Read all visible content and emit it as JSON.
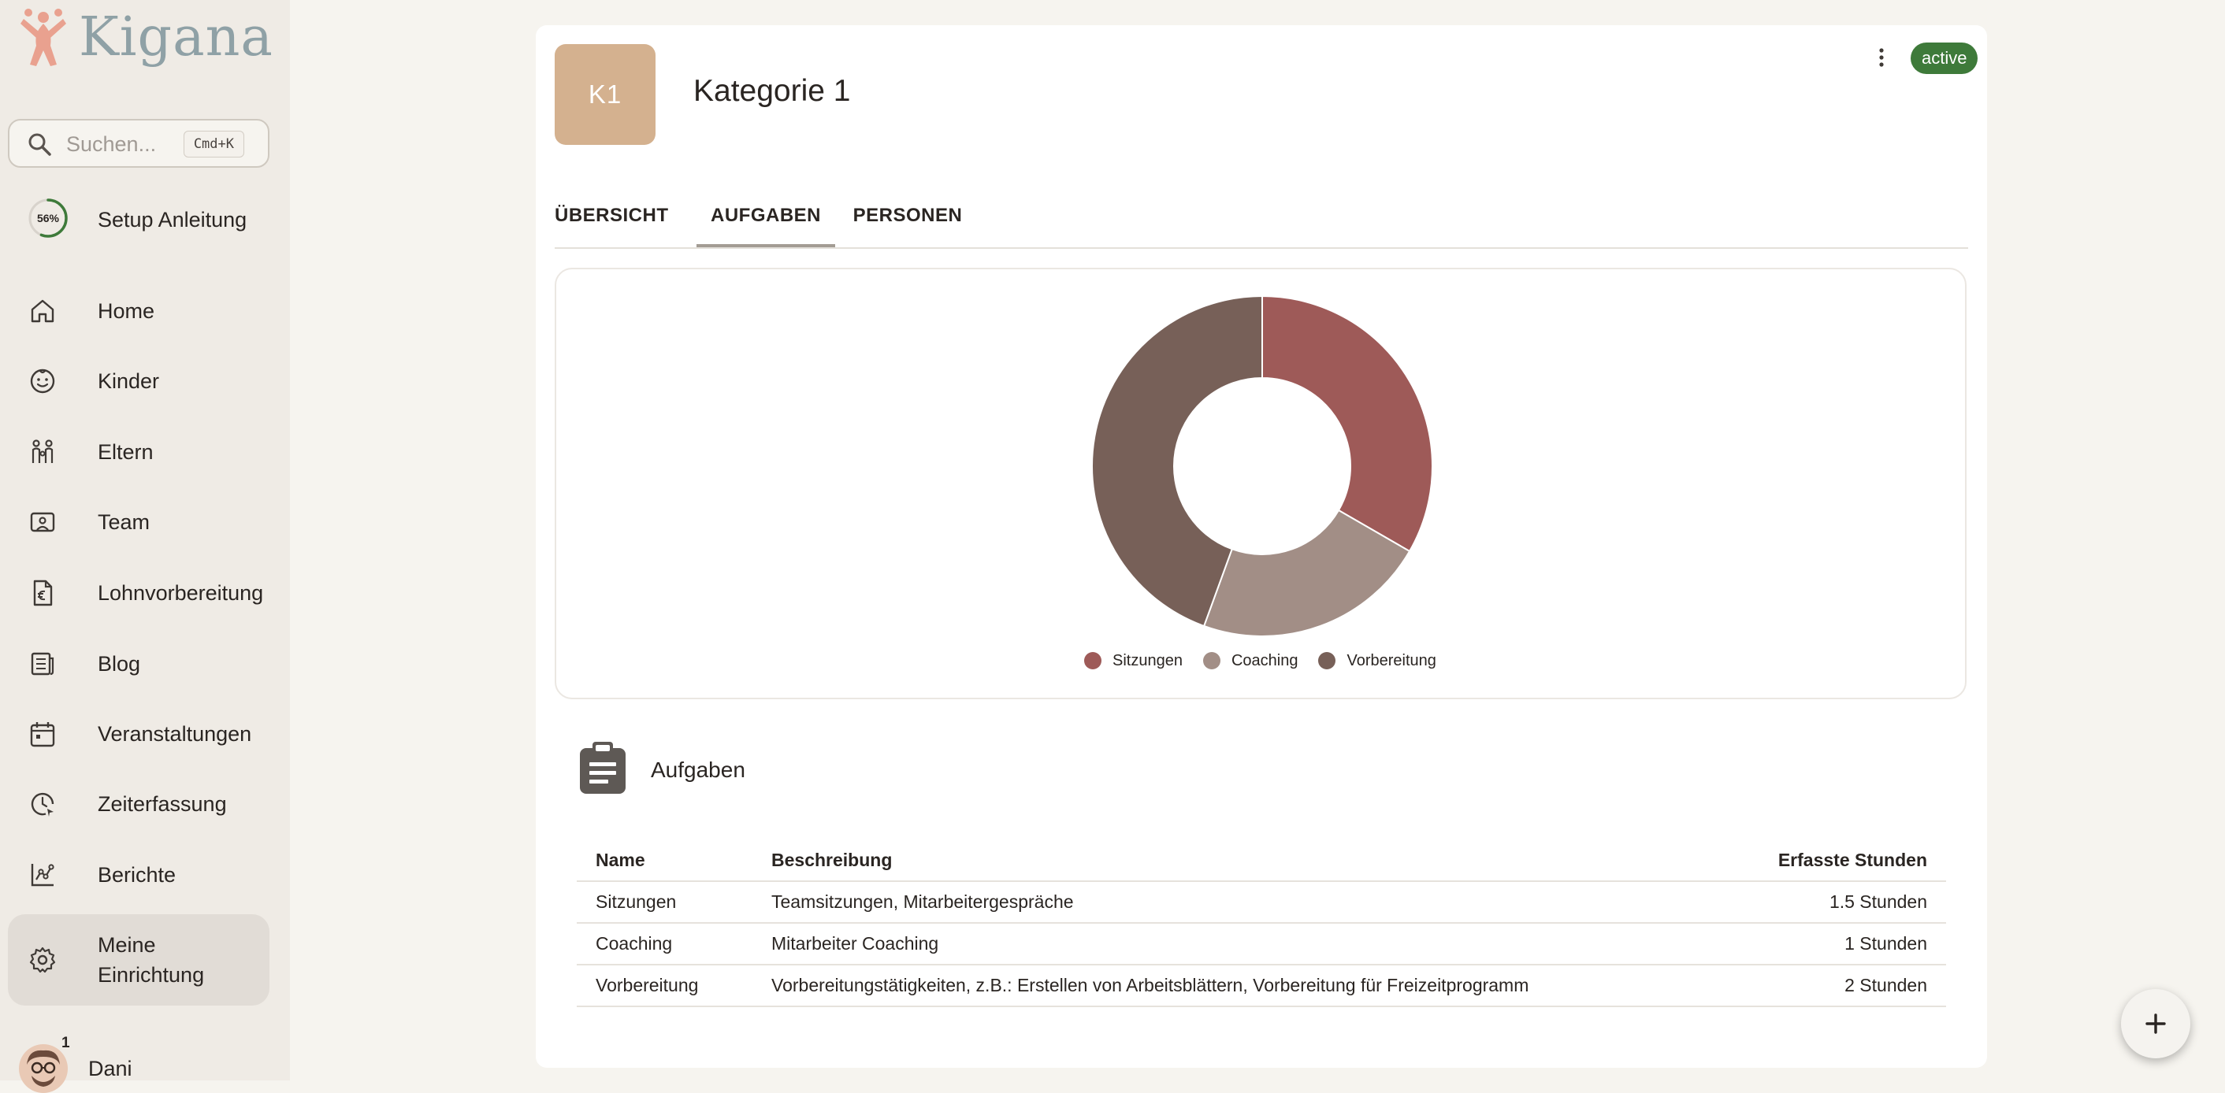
{
  "app": {
    "logo_text": "Kigana"
  },
  "search": {
    "placeholder": "Suchen...",
    "shortcut": "Cmd+K"
  },
  "setup": {
    "label": "Setup Anleitung",
    "progress_text": "56%",
    "progress": 0.56
  },
  "sidebar": {
    "items": [
      {
        "label": "Home",
        "icon": "home-icon"
      },
      {
        "label": "Kinder",
        "icon": "child-face-icon"
      },
      {
        "label": "Eltern",
        "icon": "parents-icon"
      },
      {
        "label": "Team",
        "icon": "team-badge-icon"
      },
      {
        "label": "Lohnvorbereitung",
        "icon": "payroll-document-icon"
      },
      {
        "label": "Blog",
        "icon": "blog-icon"
      },
      {
        "label": "Veranstaltungen",
        "icon": "calendar-icon"
      },
      {
        "label": "Zeiterfassung",
        "icon": "time-tracking-icon"
      },
      {
        "label": "Berichte",
        "icon": "reports-icon"
      },
      {
        "label": "Meine Einrichtung",
        "icon": "gear-icon",
        "active": true
      }
    ]
  },
  "user": {
    "name": "Dani",
    "badge": "1"
  },
  "category": {
    "initials": "K1",
    "title": "Kategorie 1",
    "status": "active"
  },
  "tabs": [
    {
      "label": "ÜBERSICHT"
    },
    {
      "label": "AUFGABEN",
      "active": true
    },
    {
      "label": "PERSONEN"
    }
  ],
  "chart_data": {
    "type": "pie",
    "donut": true,
    "categories": [
      "Sitzungen",
      "Coaching",
      "Vorbereitung"
    ],
    "values": [
      1.5,
      1,
      2
    ],
    "colors": [
      "#9e5a58",
      "#a28e86",
      "#776058"
    ],
    "legend_position": "bottom"
  },
  "tasks": {
    "title": "Aufgaben",
    "columns": [
      "Name",
      "Beschreibung",
      "Erfasste Stunden"
    ],
    "rows": [
      {
        "name": "Sitzungen",
        "description": "Teamsitzungen, Mitarbeitergespräche",
        "hours": "1.5 Stunden"
      },
      {
        "name": "Coaching",
        "description": "Mitarbeiter Coaching",
        "hours": "1 Stunden"
      },
      {
        "name": "Vorbereitung",
        "description": "Vorbereitungstätigkeiten, z.B.: Erstellen von Arbeitsblättern, Vorbereitung für Freizeitprogramm",
        "hours": "2 Stunden"
      }
    ]
  },
  "colors": {
    "status_active": "#3e7a3a",
    "avatar_bg": "#d4b18f",
    "sidebar_bg": "#efebe5"
  }
}
